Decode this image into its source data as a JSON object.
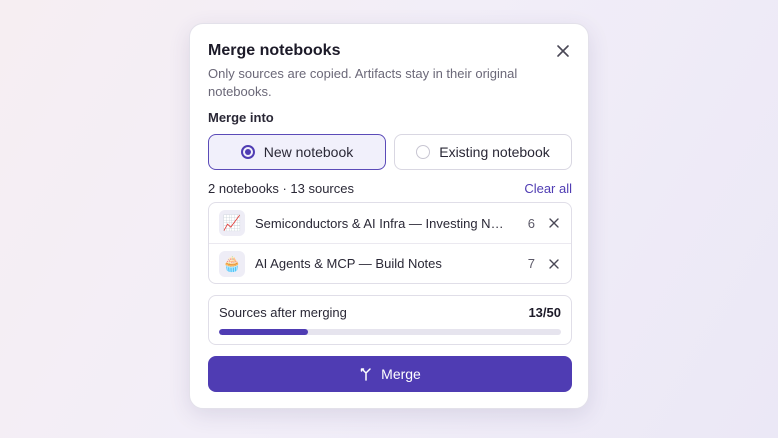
{
  "dialog": {
    "title": "Merge notebooks",
    "subtitle": "Only sources are copied. Artifacts stay in their original notebooks.",
    "close_icon": "close-icon"
  },
  "merge_into": {
    "label": "Merge into",
    "options": [
      {
        "label": "New notebook",
        "selected": true
      },
      {
        "label": "Existing notebook",
        "selected": false
      }
    ]
  },
  "selection": {
    "summary": "2 notebooks · 13 sources",
    "clear_label": "Clear all",
    "notebooks": [
      {
        "icon": "📈",
        "icon_name": "chart-increasing-icon",
        "name": "Semiconductors & AI Infra — Investing Notes",
        "count": "6"
      },
      {
        "icon": "🧁",
        "icon_name": "cupcake-icon",
        "name": "AI Agents & MCP — Build Notes",
        "count": "7"
      }
    ]
  },
  "sources": {
    "label": "Sources after merging",
    "value": "13/50",
    "fraction": 0.26
  },
  "merge_button": {
    "label": "Merge",
    "icon": "merge-icon"
  },
  "colors": {
    "accent": "#4f3cb3",
    "selected_bg": "#f1f0fb"
  }
}
